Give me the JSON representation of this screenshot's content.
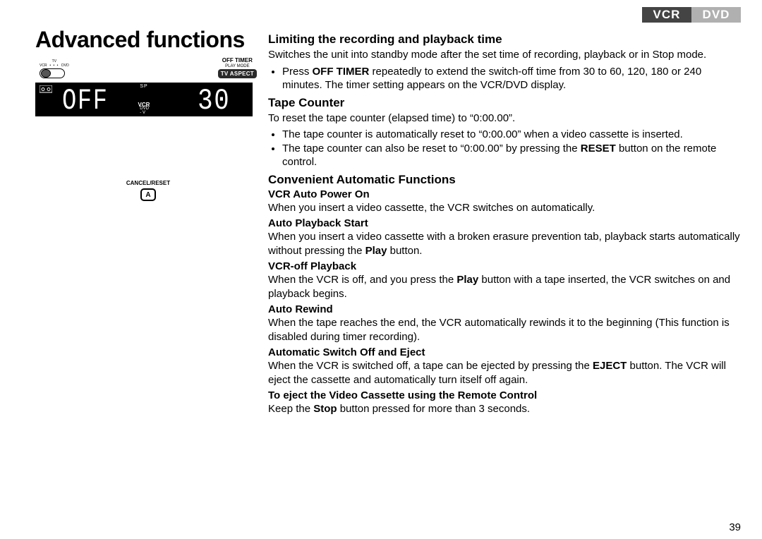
{
  "header": {
    "tab_vcr": "VCR",
    "tab_dvd": "DVD"
  },
  "title": "Advanced functions",
  "remote": {
    "slider_top": "TV",
    "slider_left": "VCR",
    "slider_right": "DVD",
    "off_timer": "OFF TIMER",
    "play_mode": "PLAY MODE",
    "tv_aspect": "TV ASPECT",
    "cancel_reset": "CANCEL/RESET",
    "btn_a": "A"
  },
  "lcd": {
    "sp": "SP",
    "vcr": "VCR",
    "dvd": "DVD",
    "minus_v": "- V",
    "seg_off": "OFF",
    "seg_30": "30"
  },
  "sec1": {
    "heading": "Limiting the recording and playback time",
    "p1": "Switches the unit into standby mode after the set time of recording, playback or in Stop mode.",
    "b1_pre": "Press ",
    "b1_bold": "OFF TIMER",
    "b1_post": " repeatedly to extend the switch-off time from 30 to 60, 120, 180 or 240 minutes. The timer setting appears on the VCR/DVD display."
  },
  "sec2": {
    "heading": "Tape Counter",
    "p1": "To reset the tape counter (elapsed time) to “0:00.00”.",
    "b1": "The tape counter is automatically reset to “0:00.00” when a video cassette is inserted.",
    "b2_pre": "The tape counter can also be reset to “0:00.00” by pressing the ",
    "b2_bold": "RESET",
    "b2_post": " button on the remote control."
  },
  "sec3": {
    "heading": "Convenient Automatic Functions",
    "s1_h": "VCR Auto Power On",
    "s1_p": "When you insert a video cassette, the VCR switches on automatically.",
    "s2_h": "Auto Playback Start",
    "s2_p_pre": "When you insert a video cassette with a broken erasure prevention tab, playback starts automatically without pressing the ",
    "s2_p_bold": "Play",
    "s2_p_post": " button.",
    "s3_h": "VCR-off Playback",
    "s3_p_pre": "When the VCR is off, and you press the ",
    "s3_p_bold": "Play",
    "s3_p_post": " button with a tape inserted, the VCR switches on and playback begins.",
    "s4_h": "Auto Rewind",
    "s4_p": "When the tape reaches the end, the VCR automatically rewinds it to the beginning (This function is disabled during timer recording).",
    "s5_h": "Automatic Switch Off and Eject",
    "s5_p_pre": "When the VCR is switched off, a tape can be ejected by pressing the ",
    "s5_p_bold": "EJECT",
    "s5_p_post": " button. The VCR will eject the cassette and automatically turn itself off again.",
    "s6_h": "To eject the Video Cassette using the Remote Control",
    "s6_p_pre": "Keep the ",
    "s6_p_bold": "Stop",
    "s6_p_post": " button pressed for more than 3 seconds."
  },
  "page_num": "39"
}
